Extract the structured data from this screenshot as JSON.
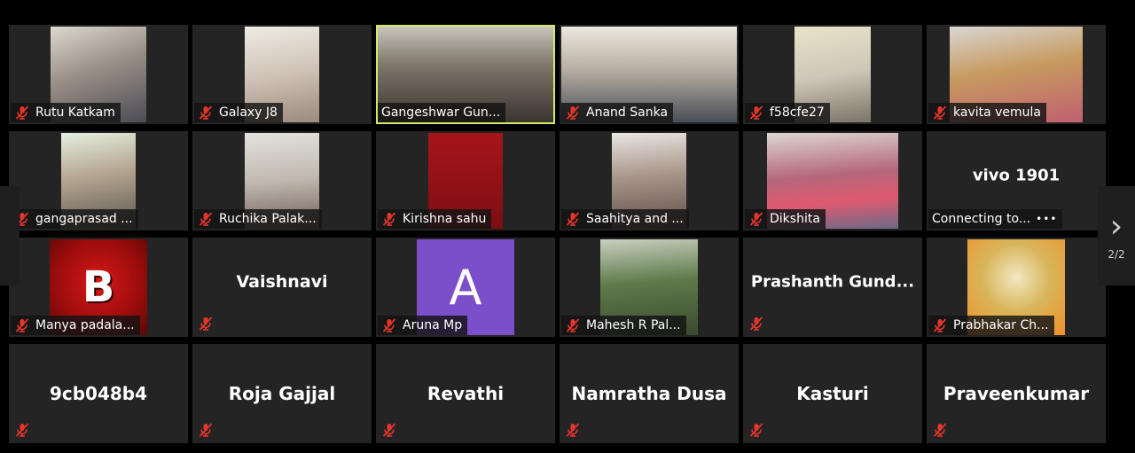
{
  "theme": {
    "tile_bg": "#242424",
    "active_border": "#d7e866",
    "mute_red": "#e5352b",
    "avatar_purple": "#7b4fc9"
  },
  "participants": [
    {
      "name": "Rutu Katkam",
      "video": true,
      "muted": true
    },
    {
      "name": "Galaxy J8",
      "video": true,
      "muted": true
    },
    {
      "name": "Gangeshwar Gun...",
      "video": true,
      "muted": false,
      "active_speaker": true
    },
    {
      "name": "Anand Sanka",
      "video": true,
      "muted": true
    },
    {
      "name": "f58cfe27",
      "video": true,
      "muted": true
    },
    {
      "name": "kavita vemula",
      "video": true,
      "muted": true
    },
    {
      "name": "gangaprasad ...",
      "video": true,
      "muted": true
    },
    {
      "name": "Ruchika Palak...",
      "video": true,
      "muted": true
    },
    {
      "name": "Kirishna sahu",
      "video": true,
      "muted": true
    },
    {
      "name": "Saahitya and ...",
      "video": true,
      "muted": true
    },
    {
      "name": "Dikshita",
      "video": true,
      "muted": true
    },
    {
      "name": "vivo 1901",
      "status": "Connecting to...",
      "video": false
    },
    {
      "name": "Manya padala...",
      "video": true,
      "muted": true
    },
    {
      "name": "Vaishnavi",
      "video": false,
      "muted": true
    },
    {
      "name": "Aruna Mp",
      "avatar_letter": "A",
      "video": false,
      "muted": true
    },
    {
      "name": "Mahesh R Pal...",
      "video": true,
      "muted": true
    },
    {
      "name": "Prashanth  Gund...",
      "video": false,
      "muted": true
    },
    {
      "name": "Prabhakar Ch...",
      "video": true,
      "muted": true
    },
    {
      "name": "9cb048b4",
      "video": false,
      "muted": true
    },
    {
      "name": "Roja Gajjal",
      "video": false,
      "muted": true
    },
    {
      "name": "Revathi",
      "video": false,
      "muted": true
    },
    {
      "name": "Namratha Dusa",
      "video": false,
      "muted": true
    },
    {
      "name": "Kasturi",
      "video": false,
      "muted": true
    },
    {
      "name": "Praveenkumar",
      "video": false,
      "muted": true
    }
  ],
  "pagination": {
    "indicator": "2/2"
  }
}
